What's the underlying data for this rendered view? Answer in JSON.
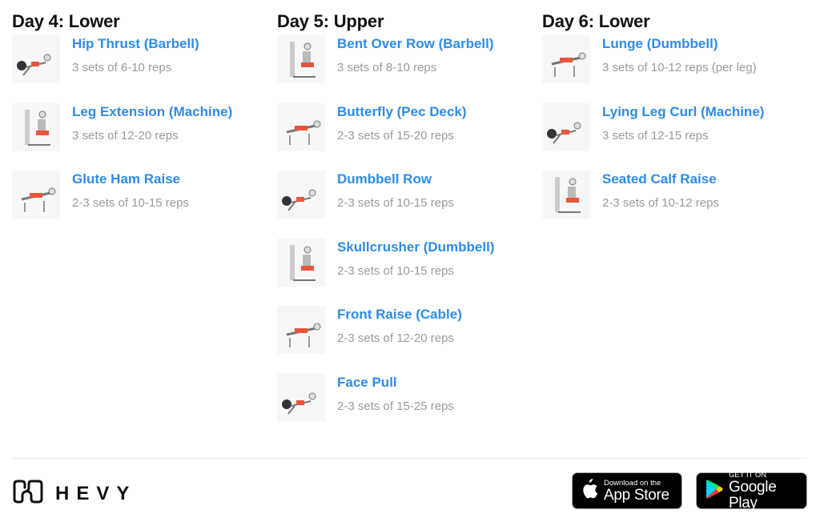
{
  "days": [
    {
      "title": "Day 4: Lower",
      "exercises": [
        {
          "name": "Hip Thrust (Barbell)",
          "sets": "3 sets of 6-10 reps"
        },
        {
          "name": "Leg Extension (Machine)",
          "sets": "3 sets of 12-20 reps"
        },
        {
          "name": "Glute Ham Raise",
          "sets": "2-3 sets of 10-15 reps"
        }
      ]
    },
    {
      "title": "Day 5: Upper",
      "exercises": [
        {
          "name": "Bent Over Row (Barbell)",
          "sets": "3 sets of 8-10 reps"
        },
        {
          "name": "Butterfly (Pec Deck)",
          "sets": "2-3 sets of 15-20 reps"
        },
        {
          "name": "Dumbbell Row",
          "sets": "2-3 sets of 10-15 reps"
        },
        {
          "name": "Skullcrusher (Dumbbell)",
          "sets": "2-3 sets of 10-15 reps"
        },
        {
          "name": "Front Raise (Cable)",
          "sets": "2-3 sets of 12-20 reps"
        },
        {
          "name": "Face Pull",
          "sets": "2-3 sets of 15-25 reps"
        }
      ]
    },
    {
      "title": "Day 6: Lower",
      "exercises": [
        {
          "name": "Lunge (Dumbbell)",
          "sets": "3 sets of 10-12 reps (per leg)"
        },
        {
          "name": "Lying Leg Curl (Machine)",
          "sets": "3 sets of 12-15 reps"
        },
        {
          "name": "Seated Calf Raise",
          "sets": "2-3 sets of 10-12 reps"
        }
      ]
    }
  ],
  "footer": {
    "brand": "HEVY",
    "app_store": {
      "small": "Download on the",
      "big": "App Store"
    },
    "google_play": {
      "small": "GET IT ON",
      "big": "Google Play"
    }
  },
  "colors": {
    "link": "#2d8cea",
    "muted": "#9a9a9a",
    "muscle_highlight": "#e8553a"
  }
}
